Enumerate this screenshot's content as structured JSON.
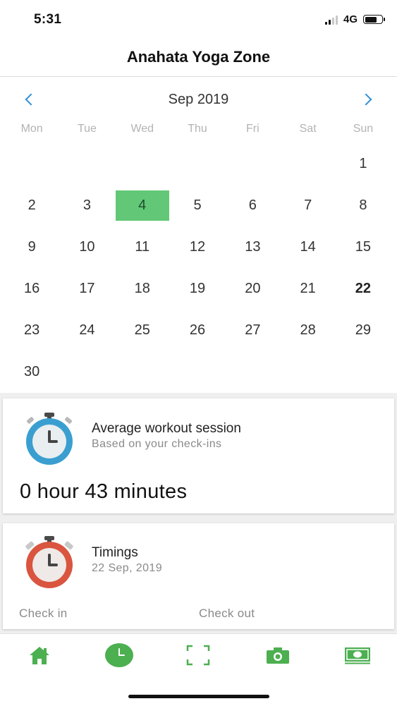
{
  "status": {
    "time": "5:31",
    "network": "4G"
  },
  "header": {
    "title": "Anahata Yoga Zone"
  },
  "calendar": {
    "month_label": "Sep 2019",
    "weekdays": [
      "Mon",
      "Tue",
      "Wed",
      "Thu",
      "Fri",
      "Sat",
      "Sun"
    ],
    "leading_blanks": 6,
    "days": [
      "1",
      "2",
      "3",
      "4",
      "5",
      "6",
      "7",
      "8",
      "9",
      "10",
      "11",
      "12",
      "13",
      "14",
      "15",
      "16",
      "17",
      "18",
      "19",
      "20",
      "21",
      "22",
      "23",
      "24",
      "25",
      "26",
      "27",
      "28",
      "29",
      "30"
    ],
    "selected_day": "4",
    "today": "22"
  },
  "average_card": {
    "title": "Average workout session",
    "subtitle": "Based on your check-ins",
    "value": "0 hour 43 minutes"
  },
  "timings_card": {
    "title": "Timings",
    "date": "22 Sep, 2019",
    "check_in_label": "Check in",
    "check_out_label": "Check out"
  },
  "tabbar": {
    "items": [
      {
        "icon": "home-icon",
        "active": false
      },
      {
        "icon": "clock-icon",
        "active": true
      },
      {
        "icon": "scan-frame-icon",
        "active": false
      },
      {
        "icon": "camera-icon",
        "active": false
      },
      {
        "icon": "cash-icon",
        "active": false
      }
    ]
  },
  "colors": {
    "accent_green": "#4caf50",
    "selected_day": "#62c877",
    "nav_blue": "#2f8fd6",
    "stopwatch_blue": "#3a9fd0",
    "stopwatch_red": "#d9553f"
  }
}
